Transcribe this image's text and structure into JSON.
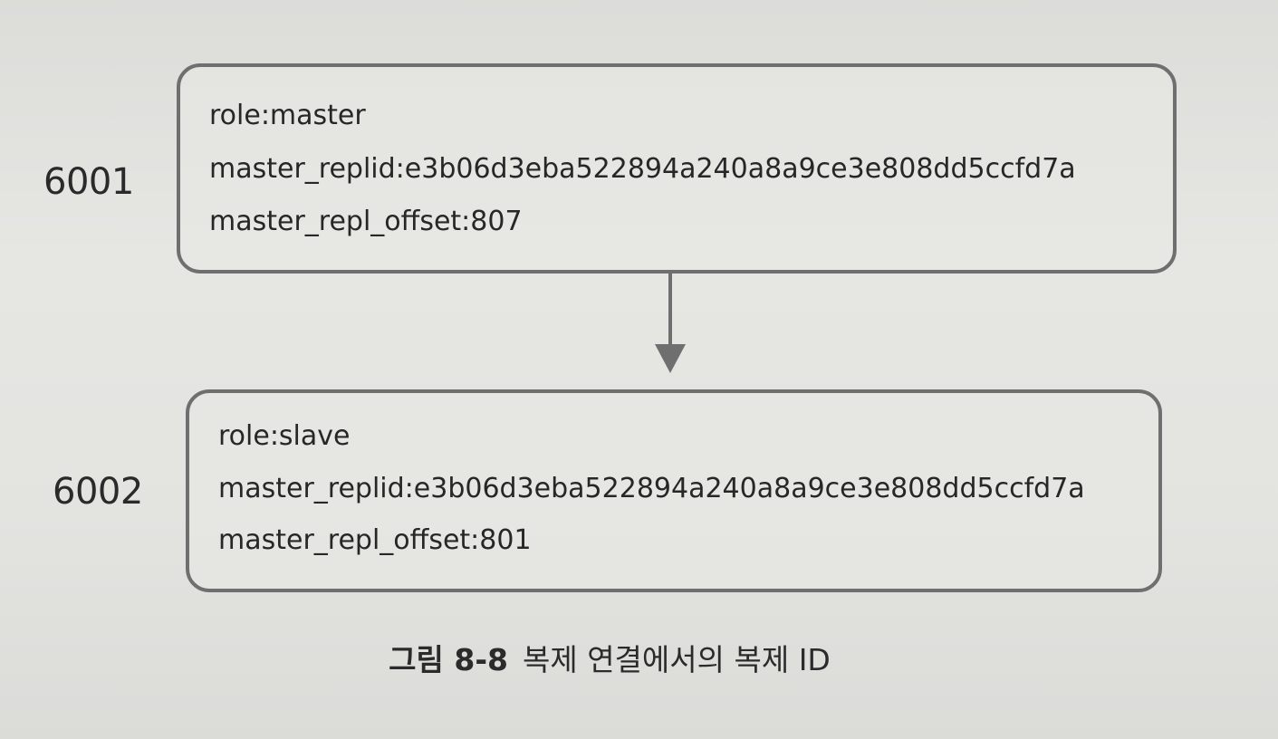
{
  "nodes": [
    {
      "port": "6001",
      "lines": [
        "role:master",
        "master_replid:e3b06d3eba522894a240a8a9ce3e808dd5ccfd7a",
        "master_repl_offset:807"
      ]
    },
    {
      "port": "6002",
      "lines": [
        "role:slave",
        "master_replid:e3b06d3eba522894a240a8a9ce3e808dd5ccfd7a",
        "master_repl_offset:801"
      ]
    }
  ],
  "caption": {
    "number": "그림 8-8",
    "text": "복제 연결에서의 복제 ID"
  },
  "colors": {
    "border": "#6f6f6f",
    "text": "#272727",
    "arrow": "#6f6f6f"
  }
}
